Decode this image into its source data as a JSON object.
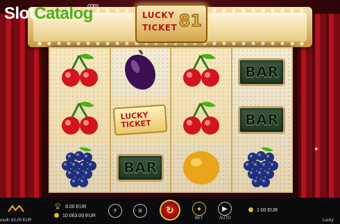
{
  "watermark": {
    "part1": "Slot",
    "part2": "Catalog",
    "suffix": ".com"
  },
  "game_logo": {
    "line1": "LUCKY",
    "line2": "TICKET",
    "number": "81"
  },
  "reels": [
    [
      {
        "symbol": "cherry",
        "win": true
      },
      {
        "symbol": "cherry",
        "win": true
      },
      {
        "symbol": "grapes",
        "win": false
      }
    ],
    [
      {
        "symbol": "plum",
        "win": false
      },
      {
        "symbol": "ticket",
        "win": true
      },
      {
        "symbol": "bar",
        "win": false
      }
    ],
    [
      {
        "symbol": "cherry",
        "win": true
      },
      {
        "symbol": "cherry",
        "win": true
      },
      {
        "symbol": "lemon",
        "win": false
      }
    ],
    [
      {
        "symbol": "bar",
        "win": false
      },
      {
        "symbol": "bar",
        "win": false
      },
      {
        "symbol": "grapes",
        "win": false
      }
    ]
  ],
  "symbols": {
    "bar_label": "BAR",
    "ticket_line1": "LUCKY",
    "ticket_line2": "TICKET"
  },
  "bottom": {
    "result_text": "esult: 63.00 EUR",
    "win_value": "8.00 EUR",
    "balance_value": "10 063.00 EUR",
    "bet_label": "BET",
    "auto_label": "AUTO",
    "bet_value": "1.00 EUR",
    "right_edge_text": "Lucky"
  },
  "icons": [
    "trophy-icon",
    "coins-icon",
    "lightning-icon",
    "menu-icon",
    "spin-icon",
    "bet-coins-icon",
    "autoplay-icon",
    "coin-icon"
  ],
  "colors": {
    "spin": "#d42020",
    "accent": "#e2b33a",
    "curtain": "#b3121e"
  }
}
